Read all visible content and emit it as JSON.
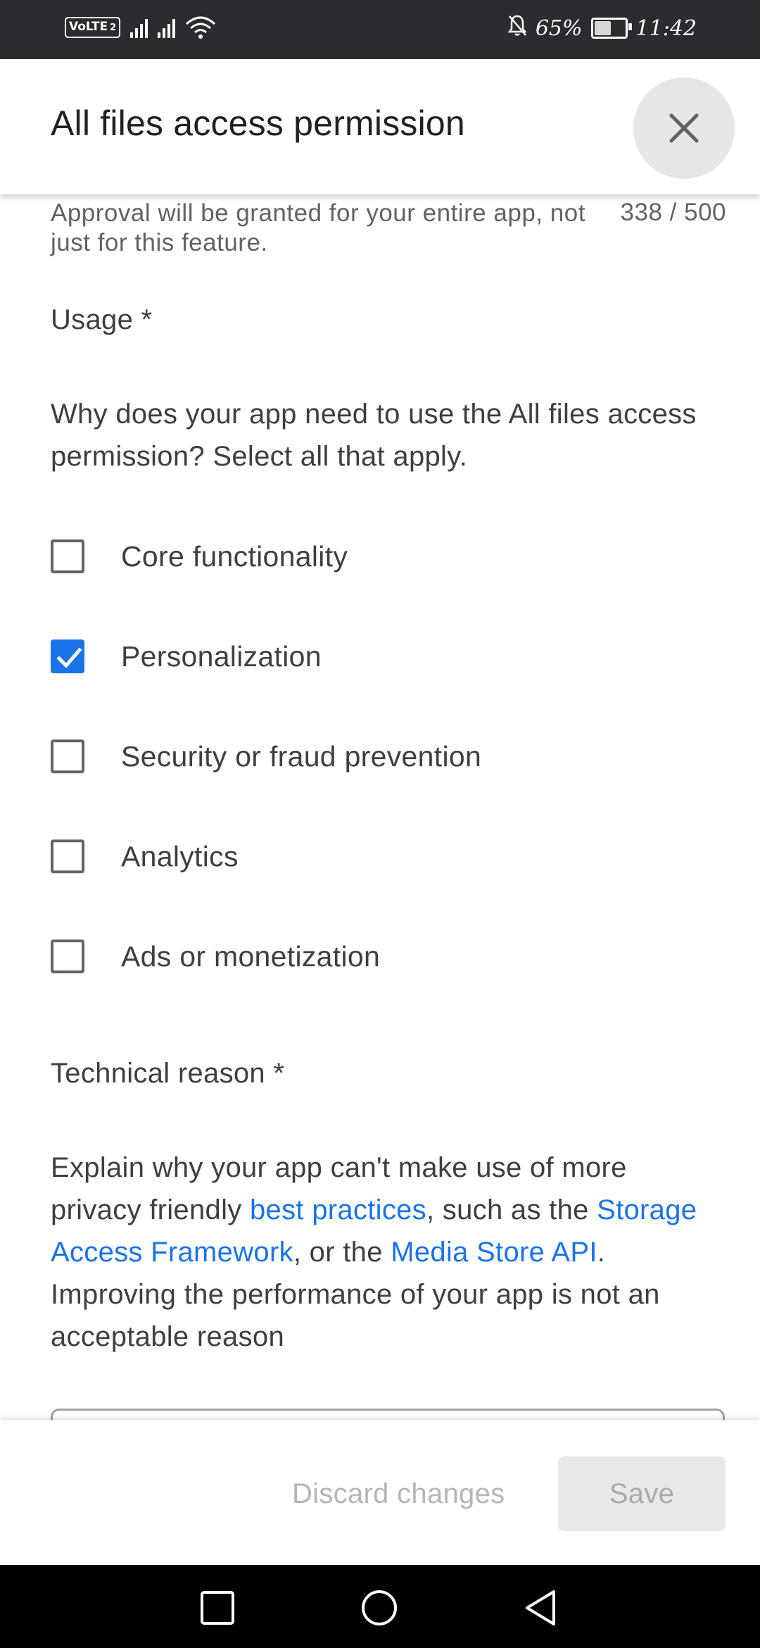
{
  "status_bar": {
    "volte": "VoLTE",
    "sim": "2",
    "battery_percent": "65%",
    "battery_level": 0.65,
    "time": "11:42"
  },
  "header": {
    "title": "All files access permission",
    "close_icon": "close-icon"
  },
  "helper": {
    "text": "Approval will be granted for your entire app, not just for this feature.",
    "counter": "338 / 500"
  },
  "usage": {
    "label": "Usage  *",
    "question": "Why does your app need to use the All files access permission? Select all that apply.",
    "options": [
      {
        "label": "Core functionality",
        "checked": false
      },
      {
        "label": "Personalization",
        "checked": true
      },
      {
        "label": "Security or fraud prevention",
        "checked": false
      },
      {
        "label": "Analytics",
        "checked": false
      },
      {
        "label": "Ads or monetization",
        "checked": false
      }
    ]
  },
  "technical": {
    "label": "Technical reason  *",
    "text_1": "Explain why your app can't make use of more privacy friendly ",
    "link_1": "best practices",
    "text_2": ", such as the ",
    "link_2": "Storage Access Framework",
    "text_3": ", or the ",
    "link_3": "Media Store API",
    "text_4": ". Improving the performance of your app is not an acceptable reason"
  },
  "footer": {
    "discard_label": "Discard changes",
    "save_label": "Save"
  },
  "colors": {
    "accent": "#1a73e8",
    "status_bar": "#2b2c30",
    "nav_bar": "#000000"
  }
}
